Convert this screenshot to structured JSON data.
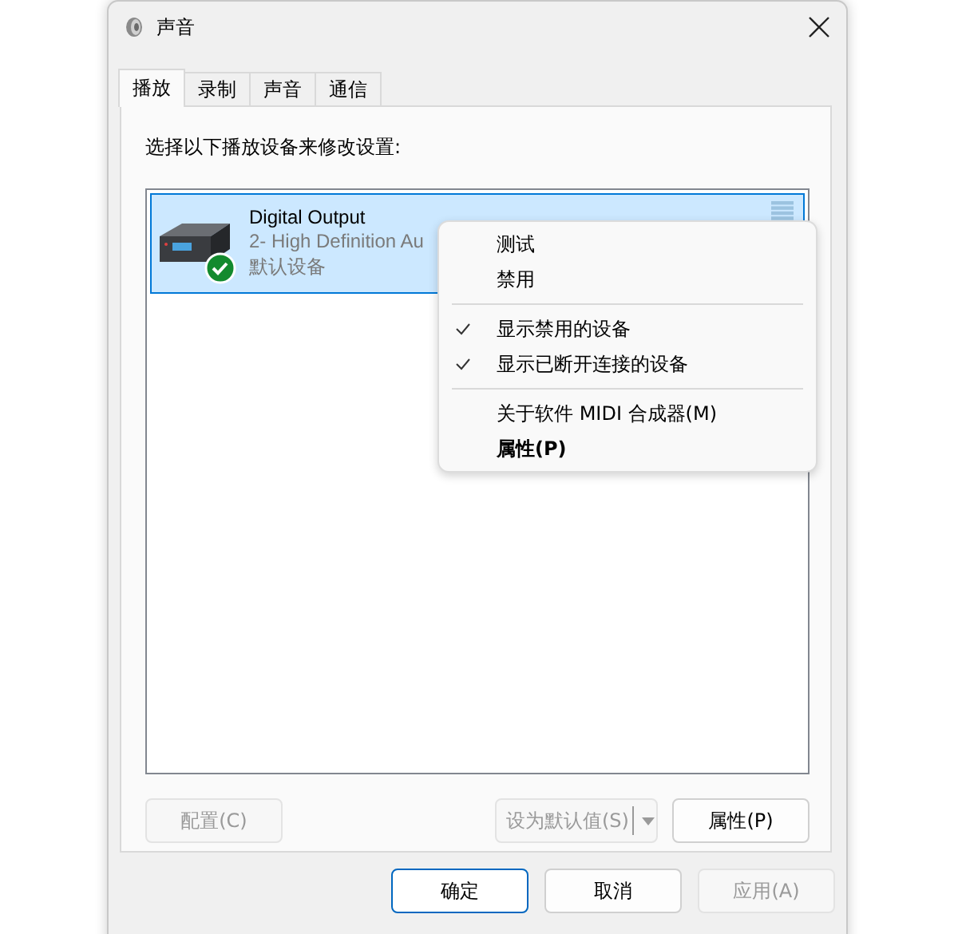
{
  "window": {
    "title": "声音"
  },
  "tabs": [
    {
      "label": "播放",
      "selected": true
    },
    {
      "label": "录制",
      "selected": false
    },
    {
      "label": "声音",
      "selected": false
    },
    {
      "label": "通信",
      "selected": false
    }
  ],
  "instruction": "选择以下播放设备来修改设置:",
  "devices": [
    {
      "name": "Digital Output",
      "description": "2- High Definition Au",
      "status": "默认设备",
      "selected": true,
      "is_default": true
    }
  ],
  "context_menu": [
    {
      "kind": "item",
      "label": "测试",
      "checked": false,
      "bold": false
    },
    {
      "kind": "item",
      "label": "禁用",
      "checked": false,
      "bold": false
    },
    {
      "kind": "separator"
    },
    {
      "kind": "item",
      "label": "显示禁用的设备",
      "checked": true,
      "bold": false
    },
    {
      "kind": "item",
      "label": "显示已断开连接的设备",
      "checked": true,
      "bold": false
    },
    {
      "kind": "separator"
    },
    {
      "kind": "item",
      "label": "关于软件 MIDI 合成器(M)",
      "checked": false,
      "bold": false
    },
    {
      "kind": "item",
      "label": "属性(P)",
      "checked": false,
      "bold": true
    }
  ],
  "panel_buttons": {
    "configure": {
      "label": "配置(C)",
      "disabled": true
    },
    "set_default": {
      "label": "设为默认值(S)",
      "disabled": true
    },
    "properties": {
      "label": "属性(P)",
      "disabled": false
    }
  },
  "dialog_buttons": [
    {
      "label": "确定",
      "disabled": false,
      "default": true
    },
    {
      "label": "取消",
      "disabled": false,
      "default": false
    },
    {
      "label": "应用(A)",
      "disabled": true,
      "default": false
    }
  ]
}
